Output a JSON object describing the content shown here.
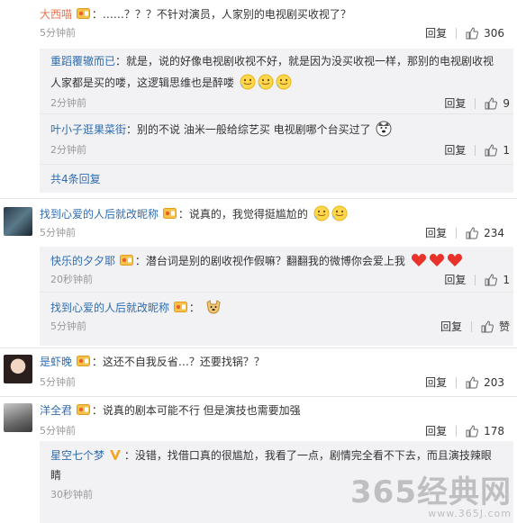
{
  "labels": {
    "reply": "回复",
    "like": "赞"
  },
  "colors": {
    "username": "#eb7350",
    "link": "#2f6db0",
    "sub_bg": "#f2f2f5"
  },
  "comments": [
    {
      "user": "大西喵",
      "text": "：……？？？不针对演员，人家别的电视剧买收视了？",
      "time": "5分钟前",
      "likes": "306",
      "replies": [
        {
          "user": "重蹈覆辙而已",
          "text": "：就是，说的好像电视剧收视不好，就是因为没买收视一样，那别的电视剧收视",
          "text2": "人家都是买的喽，这逻辑思维也是醉喽",
          "time": "2分钟前",
          "likes": "9"
        },
        {
          "user": "叶小子逛果菜街",
          "text": "：别的不说 油米一般给综艺买 电视剧哪个台买过了",
          "time": "2分钟前",
          "likes": "1"
        }
      ],
      "more": "共4条回复"
    },
    {
      "user": "找到心爱的人后就改昵称",
      "text": "：说真的，我觉得挺尴尬的",
      "time": "5分钟前",
      "likes": "234",
      "replies": [
        {
          "user": "快乐的夕夕耶",
          "text": "：潜台词是别的剧收视作假嘛？翻翻我的微博你会爱上我",
          "time": "20秒钟前",
          "likes": "1"
        },
        {
          "user": "找到心爱的人后就改昵称",
          "text": "：",
          "time": "5分钟前",
          "likes": "赞"
        }
      ]
    },
    {
      "user": "是虾晚",
      "text": "：这还不自我反省…？还要找锅？？",
      "time": "5分钟前",
      "likes": "203"
    },
    {
      "user": "洋全君",
      "text": "：说真的剧本可能不行 但是演技也需要加强",
      "time": "5分钟前",
      "likes": "178",
      "replies": [
        {
          "user": "星空七个梦",
          "text": "：没错，找借口真的很尴尬，我看了一点，剧情完全看不下去，而且演技辣眼",
          "text2": "睛",
          "time": "30秒钟前"
        }
      ]
    }
  ],
  "watermark": {
    "big": "365经典网",
    "small": "www.365J.com"
  }
}
